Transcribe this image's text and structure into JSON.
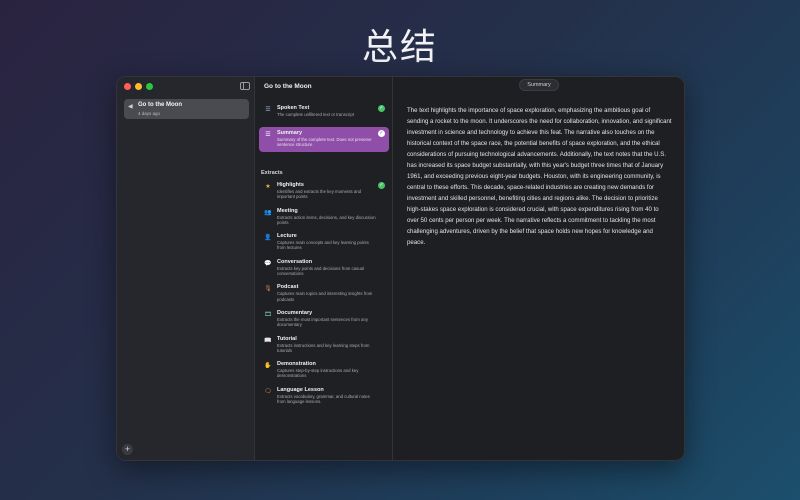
{
  "headline": "总结",
  "app": {
    "sidebar": {
      "recordings": [
        {
          "title": "Go to the Moon",
          "date": "4 days ago",
          "icon": "waveform-icon"
        }
      ],
      "add_label": "+"
    },
    "document": {
      "title": "Go to the Moon",
      "outputs": [
        {
          "label": "Spoken Text",
          "desc": "The complete unfiltered text or transcript",
          "icon": "text-doc-icon",
          "done": true,
          "selected": false
        },
        {
          "label": "Summary",
          "desc": "Summary of the complete text. Does not preserve sentence structure",
          "icon": "summary-icon",
          "done": true,
          "selected": true
        }
      ],
      "extracts_label": "Extracts",
      "extracts": [
        {
          "label": "Highlights",
          "desc": "Identifies and extracts the key moments and important points",
          "icon": "star-icon",
          "glyph": "★",
          "color": "#f0b43c",
          "done": true
        },
        {
          "label": "Meeting",
          "desc": "Extracts action items, decisions, and key discussion points",
          "icon": "people-icon",
          "glyph": "👥",
          "color": "#e07a7a",
          "done": false
        },
        {
          "label": "Lecture",
          "desc": "Captures main concepts and key learning points from lectures",
          "icon": "person-icon",
          "glyph": "👤",
          "color": "#d98ad0",
          "done": false
        },
        {
          "label": "Conversation",
          "desc": "Extracts key points and decisions from casual conversations",
          "icon": "chat-bubbles-icon",
          "glyph": "💬",
          "color": "#7fb6e0",
          "done": false
        },
        {
          "label": "Podcast",
          "desc": "Captures main topics and interesting insights from podcasts",
          "icon": "microphone-icon",
          "glyph": "🎙",
          "color": "#e07a5a",
          "done": false
        },
        {
          "label": "Documentary",
          "desc": "Extracts the most important sentences from any documentary",
          "icon": "film-icon",
          "glyph": "🎞",
          "color": "#7fc0a0",
          "done": false
        },
        {
          "label": "Tutorial",
          "desc": "Extracts instructions and key learning steps from tutorials",
          "icon": "book-icon",
          "glyph": "📖",
          "color": "#e0b060",
          "done": false
        },
        {
          "label": "Demonstration",
          "desc": "Captures step-by-step instructions and key demonstrations",
          "icon": "hand-icon",
          "glyph": "✋",
          "color": "#c0c0c8",
          "done": false
        },
        {
          "label": "Language Lesson",
          "desc": "Extracts vocabulary, grammar, and cultural notes from language lessons.",
          "icon": "speech-icon",
          "glyph": "🗨",
          "color": "#e08a5a",
          "done": false
        }
      ]
    },
    "content": {
      "tab": "Summary",
      "text": "The text highlights the importance of space exploration, emphasizing the ambitious goal of sending a rocket to the moon. It underscores the need for collaboration, innovation, and significant investment in science and technology to achieve this feat. The narrative also touches on the historical context of the space race, the potential benefits of space exploration, and the ethical considerations of pursuing technological advancements. Additionally, the text notes that the U.S. has increased its space budget substantially, with this year's budget three times that of January 1961, and exceeding previous eight-year budgets. Houston, with its engineering community, is central to these efforts. This decade, space-related industries are creating new demands for investment and skilled personnel, benefiting cities and regions alike. The decision to prioritize high-stakes space exploration is considered crucial, with space expenditures rising from 40 to over 50 cents per person per week. The narrative reflects a commitment to tackling the most challenging adventures, driven by the belief that space holds new hopes for knowledge and peace."
    }
  }
}
